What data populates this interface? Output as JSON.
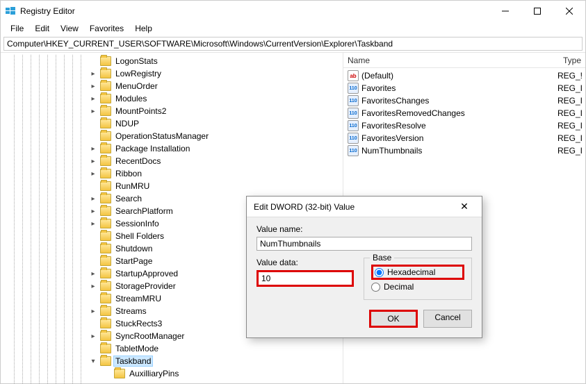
{
  "window": {
    "title": "Registry Editor"
  },
  "menu": {
    "file": "File",
    "edit": "Edit",
    "view": "View",
    "favorites": "Favorites",
    "help": "Help"
  },
  "address": "Computer\\HKEY_CURRENT_USER\\SOFTWARE\\Microsoft\\Windows\\CurrentVersion\\Explorer\\Taskband",
  "tree": [
    {
      "label": "LogonStats",
      "exp": ""
    },
    {
      "label": "LowRegistry",
      "exp": ">"
    },
    {
      "label": "MenuOrder",
      "exp": ">"
    },
    {
      "label": "Modules",
      "exp": ">"
    },
    {
      "label": "MountPoints2",
      "exp": ">"
    },
    {
      "label": "NDUP",
      "exp": ""
    },
    {
      "label": "OperationStatusManager",
      "exp": ""
    },
    {
      "label": "Package Installation",
      "exp": ">"
    },
    {
      "label": "RecentDocs",
      "exp": ">"
    },
    {
      "label": "Ribbon",
      "exp": ">"
    },
    {
      "label": "RunMRU",
      "exp": ""
    },
    {
      "label": "Search",
      "exp": ">"
    },
    {
      "label": "SearchPlatform",
      "exp": ">"
    },
    {
      "label": "SessionInfo",
      "exp": ">"
    },
    {
      "label": "Shell Folders",
      "exp": ""
    },
    {
      "label": "Shutdown",
      "exp": ""
    },
    {
      "label": "StartPage",
      "exp": ""
    },
    {
      "label": "StartupApproved",
      "exp": ">"
    },
    {
      "label": "StorageProvider",
      "exp": ">"
    },
    {
      "label": "StreamMRU",
      "exp": ""
    },
    {
      "label": "Streams",
      "exp": ">"
    },
    {
      "label": "StuckRects3",
      "exp": ""
    },
    {
      "label": "SyncRootManager",
      "exp": ">"
    },
    {
      "label": "TabletMode",
      "exp": ""
    },
    {
      "label": "Taskband",
      "exp": "v",
      "sel": true
    },
    {
      "label": "AuxilliaryPins",
      "exp": "",
      "child": true
    }
  ],
  "list": {
    "cols": {
      "name": "Name",
      "type": "Type"
    },
    "rows": [
      {
        "icon": "sz",
        "name": "(Default)",
        "type": "REG_!"
      },
      {
        "icon": "bin",
        "name": "Favorites",
        "type": "REG_I"
      },
      {
        "icon": "bin",
        "name": "FavoritesChanges",
        "type": "REG_I"
      },
      {
        "icon": "bin",
        "name": "FavoritesRemovedChanges",
        "type": "REG_I"
      },
      {
        "icon": "bin",
        "name": "FavoritesResolve",
        "type": "REG_I"
      },
      {
        "icon": "bin",
        "name": "FavoritesVersion",
        "type": "REG_I"
      },
      {
        "icon": "bin",
        "name": "NumThumbnails",
        "type": "REG_I"
      }
    ]
  },
  "dialog": {
    "title": "Edit DWORD (32-bit) Value",
    "value_name_label": "Value name:",
    "value_name": "NumThumbnails",
    "value_data_label": "Value data:",
    "value_data": "10",
    "base_label": "Base",
    "hex_label": "Hexadecimal",
    "dec_label": "Decimal",
    "ok": "OK",
    "cancel": "Cancel"
  }
}
